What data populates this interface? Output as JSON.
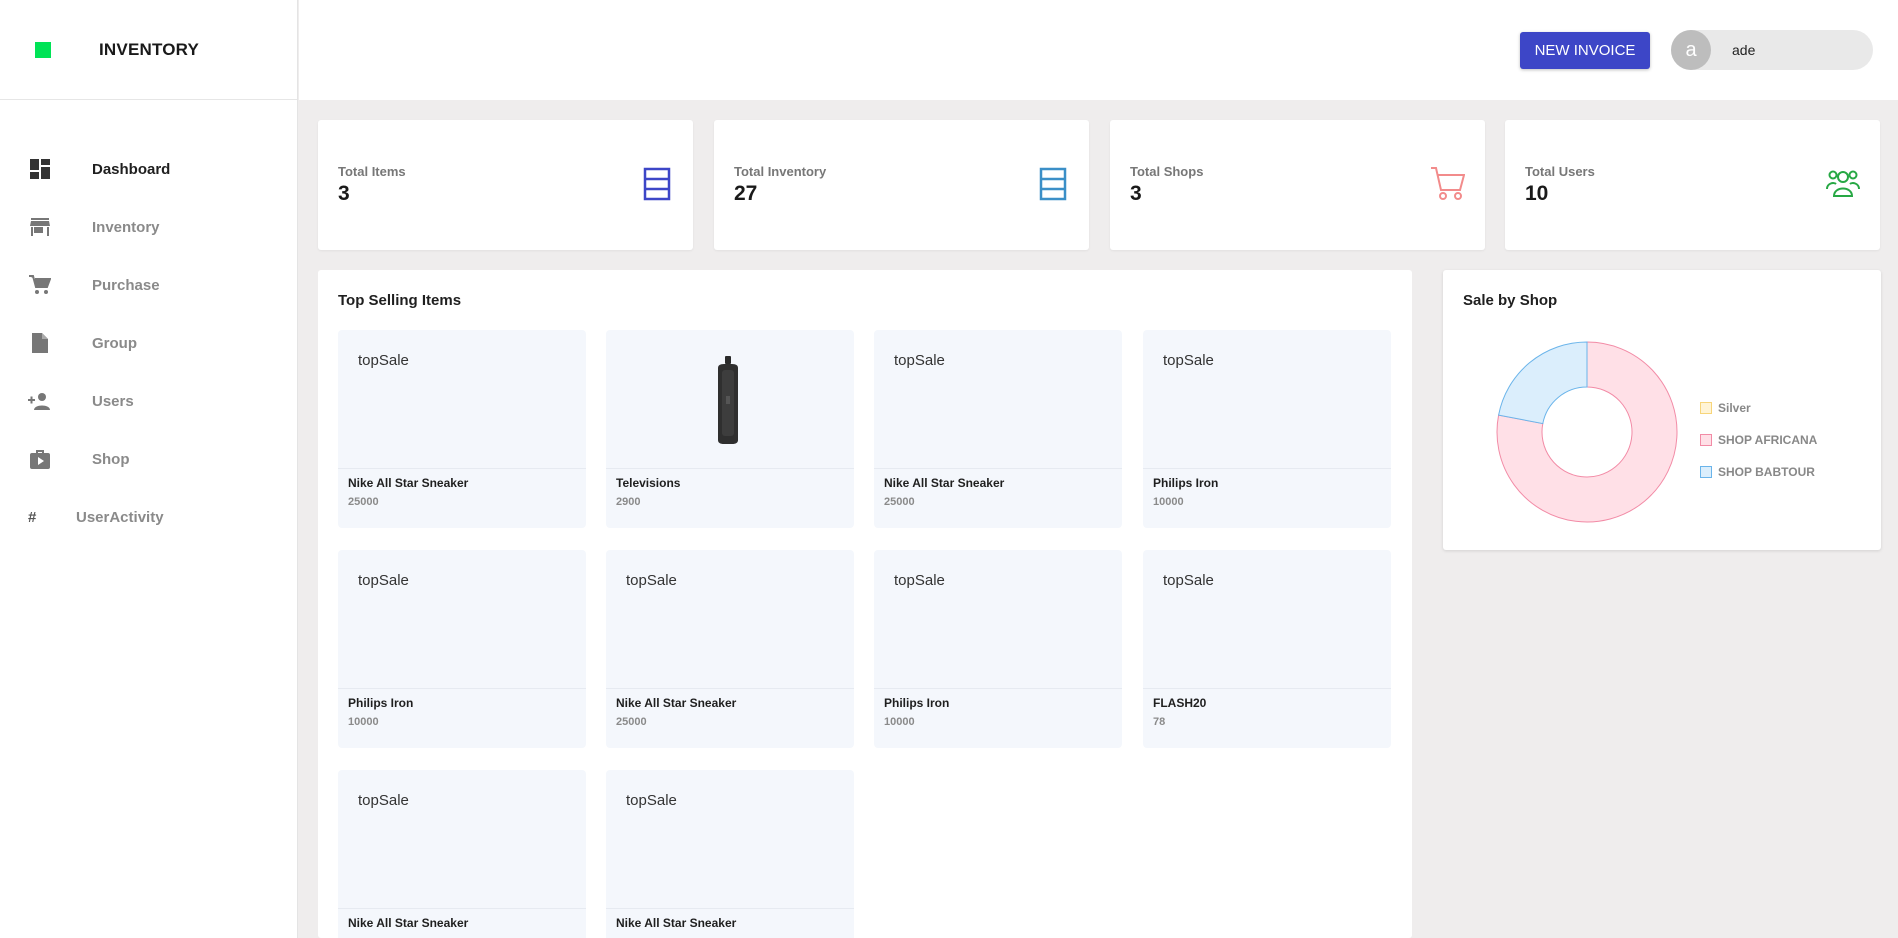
{
  "app": {
    "title": "INVENTORY",
    "brand_color": "#00e356"
  },
  "sidebar": {
    "items": [
      {
        "label": "Dashboard",
        "icon": "dashboard-icon",
        "active": true
      },
      {
        "label": "Inventory",
        "icon": "store-icon"
      },
      {
        "label": "Purchase",
        "icon": "cart-icon"
      },
      {
        "label": "Group",
        "icon": "file-icon"
      },
      {
        "label": "Users",
        "icon": "users-icon"
      },
      {
        "label": "Shop",
        "icon": "shop-icon"
      },
      {
        "label": "UserActivity",
        "icon": "hash-icon",
        "prefix": "#"
      }
    ]
  },
  "topbar": {
    "new_invoice": "NEW INVOICE",
    "user": {
      "initial": "a",
      "name": "ade"
    }
  },
  "stats": [
    {
      "label": "Total Items",
      "value": "3",
      "icon": "stack-icon",
      "color": "#3d46c7"
    },
    {
      "label": "Total Inventory",
      "value": "27",
      "icon": "stack-icon",
      "color": "#3b8fc7"
    },
    {
      "label": "Total Shops",
      "value": "3",
      "icon": "cart-icon",
      "color": "#f28b8b"
    },
    {
      "label": "Total Users",
      "value": "10",
      "icon": "users-icon",
      "color": "#27a844"
    }
  ],
  "top_selling": {
    "title": "Top Selling Items",
    "items": [
      {
        "alt": "topSale",
        "name": "Nike All Star Sneaker",
        "price": "25000"
      },
      {
        "alt": "",
        "name": "Televisions",
        "price": "2900",
        "image": "phone-image"
      },
      {
        "alt": "topSale",
        "name": "Nike All Star Sneaker",
        "price": "25000"
      },
      {
        "alt": "topSale",
        "name": "Philips Iron",
        "price": "10000"
      },
      {
        "alt": "topSale",
        "name": "Philips Iron",
        "price": "10000"
      },
      {
        "alt": "topSale",
        "name": "Nike All Star Sneaker",
        "price": "25000"
      },
      {
        "alt": "topSale",
        "name": "Philips Iron",
        "price": "10000"
      },
      {
        "alt": "topSale",
        "name": "FLASH20",
        "price": "78"
      },
      {
        "alt": "topSale",
        "name": "Nike All Star Sneaker",
        "price": ""
      },
      {
        "alt": "topSale",
        "name": "Nike All Star Sneaker",
        "price": ""
      }
    ]
  },
  "sale_by_shop": {
    "title": "Sale by Shop",
    "chart_data": {
      "type": "pie",
      "categories": [
        "Silver",
        "SHOP AFRICANA",
        "SHOP BABTOUR"
      ],
      "values": [
        0,
        78,
        22
      ],
      "colors": [
        "#fff4d6",
        "#ffe0e7",
        "#dbeefc"
      ],
      "border_colors": [
        "#f7d57a",
        "#f28ba6",
        "#6ab4ea"
      ]
    }
  }
}
